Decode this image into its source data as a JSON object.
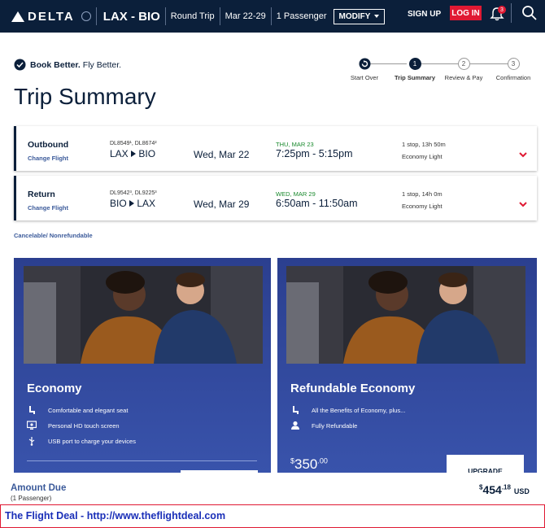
{
  "header": {
    "brand": "DELTA",
    "route": "LAX - BIO",
    "trip_type": "Round Trip",
    "dates": "Mar 22-29",
    "passengers": "1 Passenger",
    "modify_label": "MODIFY",
    "signup_label": "SIGN UP",
    "login_label": "LOG IN",
    "notification_count": "3"
  },
  "tagline": {
    "bold": "Book Better.",
    "rest": " Fly Better."
  },
  "page_title": "Trip Summary",
  "steps": [
    {
      "label": "Start Over",
      "number": ""
    },
    {
      "label": "Trip Summary",
      "number": "1"
    },
    {
      "label": "Review & Pay",
      "number": "2"
    },
    {
      "label": "Confirmation",
      "number": "3"
    }
  ],
  "flights": [
    {
      "type": "Outbound",
      "change_label": "Change Flight",
      "flight_numbers": "DL8549¹, DL8674²",
      "origin": "LAX",
      "destination": "BIO",
      "date": "Wed, Mar 22",
      "arrival_day": "THU, MAR 23",
      "times": "7:25pm - 5:15pm",
      "stops": "1 stop, 13h 50m",
      "cabin": "Economy Light"
    },
    {
      "type": "Return",
      "change_label": "Change Flight",
      "flight_numbers": "DL9542³, DL9225³",
      "origin": "BIO",
      "destination": "LAX",
      "date": "Wed, Mar 29",
      "arrival_day": "WED, MAR 29",
      "times": "6:50am - 11:50am",
      "stops": "1 stop, 14h 0m",
      "cabin": "Economy Light"
    }
  ],
  "cancel_policy": "Cancelable/ Nonrefundable",
  "fares": [
    {
      "name": "Economy",
      "features": [
        {
          "icon": "seat-icon",
          "text": "Comfortable and elegant seat"
        },
        {
          "icon": "screen-icon",
          "text": "Personal HD touch screen"
        },
        {
          "icon": "usb-icon",
          "text": "USB port to charge your devices"
        }
      ],
      "price": "",
      "button": ""
    },
    {
      "name": "Refundable Economy",
      "features": [
        {
          "icon": "seat-icon",
          "text": "All the Benefits of Economy, plus..."
        },
        {
          "icon": "person-icon",
          "text": "Fully Refundable"
        }
      ],
      "price_dollars": "350",
      "price_cents": ".00",
      "currency_symbol": "$",
      "button": "UPGRADE"
    }
  ],
  "amount_due": {
    "label": "Amount Due",
    "passengers": "(1 Passenger)",
    "currency_symbol": "$",
    "dollars": "454",
    "cents": ".18",
    "currency": "USD"
  },
  "promo": "The Flight Deal - http://www.theflightdeal.com",
  "colors": {
    "navy": "#0b1f3a",
    "red": "#e01933",
    "card_blue": "#2b3f8f",
    "link_blue": "#3b5a9a",
    "green": "#1a8a2e"
  }
}
